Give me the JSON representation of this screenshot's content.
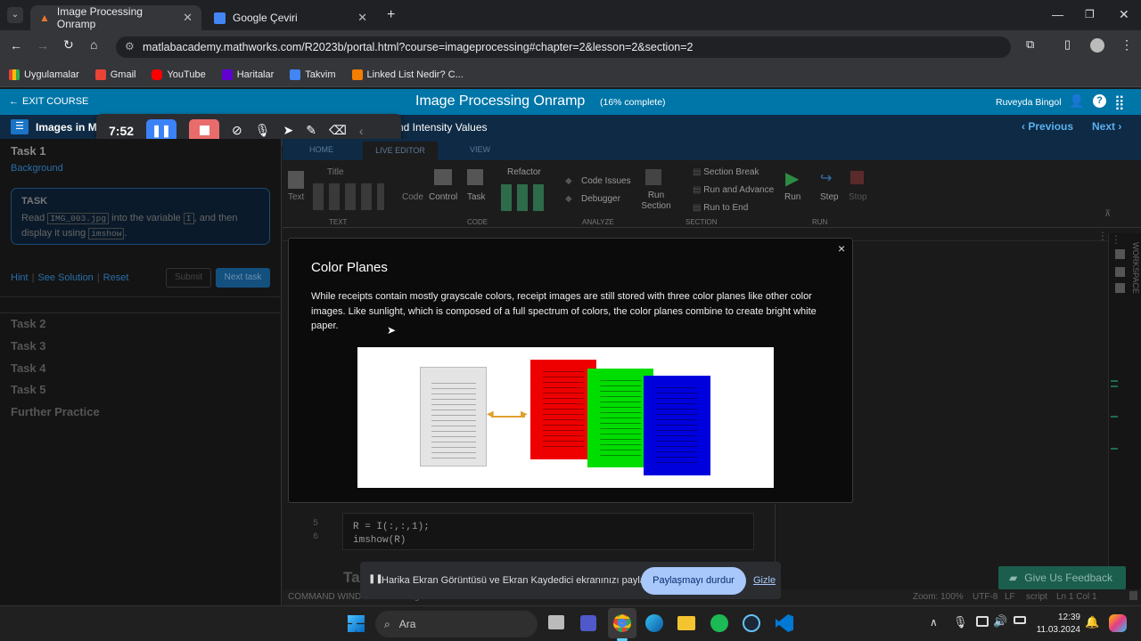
{
  "browser": {
    "tabs": [
      {
        "title": "Image Processing Onramp",
        "active": true
      },
      {
        "title": "Google Çeviri",
        "active": false
      }
    ],
    "url": "matlabacademy.mathworks.com/R2023b/portal.html?course=imageprocessing#chapter=2&lesson=2&section=2",
    "bookmarks": [
      "Uygulamalar",
      "Gmail",
      "YouTube",
      "Haritalar",
      "Takvim",
      "Linked List Nedir? C..."
    ]
  },
  "course": {
    "exit_label": "EXIT COURSE",
    "title": "Image Processing Onramp",
    "progress": "(16% complete)",
    "user": "Ruveyda Bingol",
    "lesson_left": "Images in Ma",
    "lesson_right": "nd Intensity Values",
    "previous": "Previous",
    "next": "Next"
  },
  "recorder": {
    "time": "7:52"
  },
  "left_panel": {
    "task1": "Task 1",
    "background": "Background",
    "task_heading": "TASK",
    "task_text_1": "Read",
    "task_code_1": "IMG_003.jpg",
    "task_text_2": "into the variable",
    "task_code_2": "I",
    "task_text_3": ", and then",
    "task_text_4": "display it using",
    "task_code_3": "imshow",
    "task_text_5": ".",
    "hint": "Hint",
    "see_solution": "See Solution",
    "reset": "Reset",
    "submit": "Submit",
    "next_task": "Next task",
    "tasks": [
      "Task 2",
      "Task 3",
      "Task 4",
      "Task 5",
      "Further Practice"
    ]
  },
  "ribbon": {
    "tabs": [
      "HOME",
      "LIVE EDITOR",
      "VIEW"
    ],
    "text_group": {
      "text": "Text",
      "title": "Title",
      "label": "TEXT"
    },
    "code_group": {
      "code": "Code",
      "control": "Control",
      "task": "Task",
      "refactor": "Refactor",
      "label": "CODE"
    },
    "analyze_group": {
      "code_issues": "Code Issues",
      "debugger": "Debugger",
      "label": "ANALYZE"
    },
    "section_group": {
      "run_section": "Run Section",
      "section_break": "Section Break",
      "run_and_advance": "Run and Advance",
      "run_to_end": "Run to End",
      "label": "SECTION"
    },
    "run_group": {
      "run": "Run",
      "step": "Step",
      "stop": "Stop",
      "label": "RUN"
    },
    "workspace": "WORKSPACE"
  },
  "editor": {
    "line_numbers": [
      "5",
      "6"
    ],
    "code_lines": [
      "R = I(:,:,1);",
      "imshow(R)"
    ],
    "section_heading": "Tas"
  },
  "modal": {
    "close": "×",
    "title": "Color Planes",
    "body": "While receipts contain mostly grayscale colors, receipt images are still stored with three color planes like other color images. Like sunlight, which is composed of a full spectrum of colors, the color planes combine to create bright white paper."
  },
  "status": {
    "command_window": "COMMAND WINDOW",
    "passages": "Passages of 7 found",
    "zoom": "Zoom: 100%",
    "encoding": "UTF-8",
    "eol": "LF",
    "mode": "script",
    "position": "Ln 1 Col 1"
  },
  "share_bar": {
    "message": "Harika Ekran Görüntüsü ve Ekran Kaydedici ekranınızı paylaşıyor.",
    "stop": "Paylaşmayı durdur",
    "hide": "Gizle"
  },
  "feedback": "Give Us Feedback",
  "taskbar": {
    "search": "Ara",
    "time": "12:39",
    "date": "11.03.2024"
  },
  "colors": {
    "brand_blue": "#0076a8",
    "dark_blue": "#0e2a44",
    "next_task_btn": "#1c6fb6",
    "share_stop_btn": "#a8c7fa"
  }
}
